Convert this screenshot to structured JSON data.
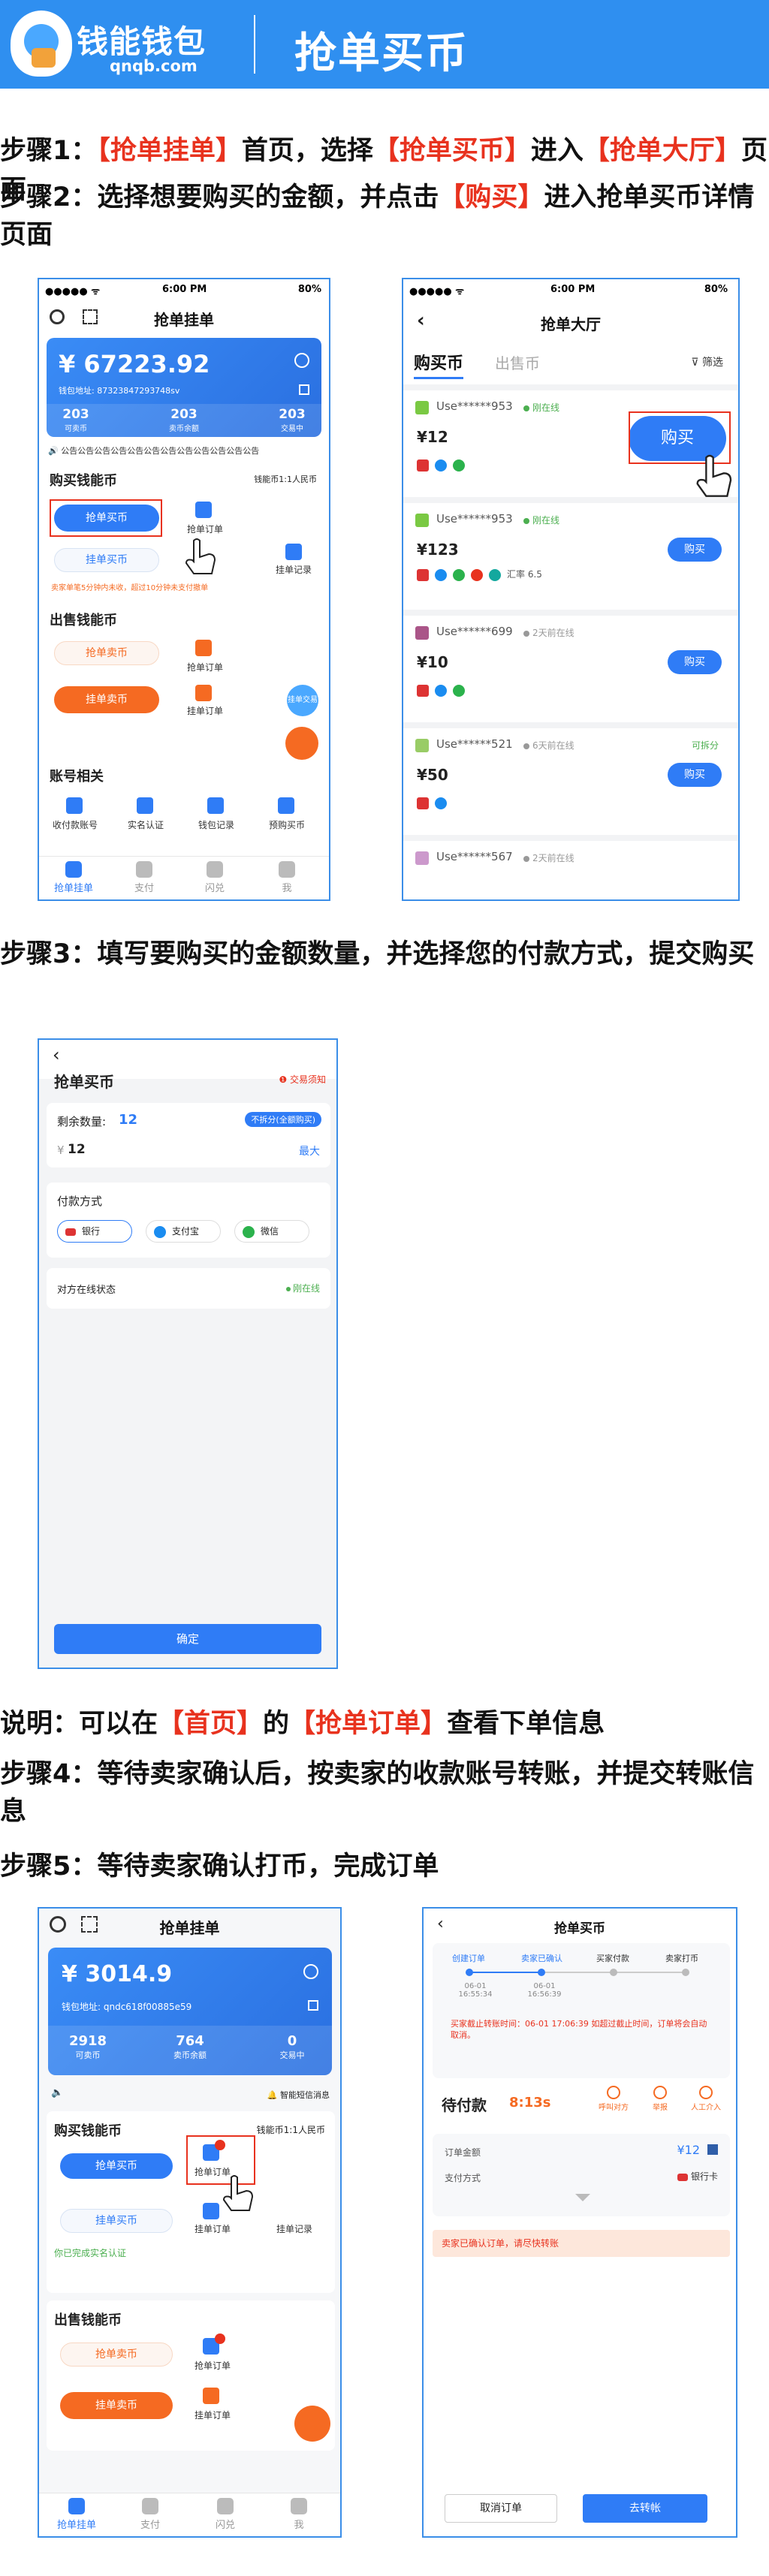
{
  "header": {
    "brand": "钱能钱包",
    "domain": "qnqb.com",
    "title": "抢单买币"
  },
  "steps": {
    "s1": {
      "pre": "步骤1：",
      "h1": "【抢单挂单】",
      "m1": "首页，选择",
      "h2": "【抢单买币】",
      "m2": "进入",
      "h3": "【抢单大厅】",
      "post": "页面"
    },
    "s2": {
      "pre": "步骤2：选择想要购买的金额，并点击",
      "h1": "【购买】",
      "post": "进入抢单买币详情页面"
    },
    "s3": {
      "text": "步骤3：填写要购买的金额数量，并选择您的付款方式，提交购买"
    },
    "note": {
      "pre": "说明：可以在",
      "h1": "【首页】",
      "m1": "的",
      "h2": "【抢单订单】",
      "post": "查看下单信息"
    },
    "s4": {
      "text": "步骤4：等待卖家确认后，按卖家的收款账号转账，并提交转账信息"
    },
    "s5": {
      "text": "步骤5：等待卖家确认打币，完成订单"
    }
  },
  "statusbar": {
    "carrier": "●●●●● ᯤ",
    "time": "6:00 PM",
    "battery": "80%"
  },
  "phone1": {
    "title": "抢单挂单",
    "amount": "¥ 67223.92",
    "address": "钱包地址: 87323847293748sv",
    "stats": [
      {
        "num": "203",
        "label": "可卖币"
      },
      {
        "num": "203",
        "label": "卖币余额"
      },
      {
        "num": "203",
        "label": "交易中"
      }
    ],
    "notice": "公告公告公告公告公告公告公告公告公告公告公告公告",
    "buy_title": "购买钱能币",
    "rate": "钱能币1:1人民币",
    "buy_btn": "抢单买币",
    "order_label": "抢单订单",
    "hang_buy": "挂单买币",
    "hang_record": "挂单记录",
    "warn": "卖家单笔5分钟内未收，超过10分钟未支付撤单",
    "sell_title": "出售钱能币",
    "sell_btn": "抢单卖币",
    "sell_order": "抢单订单",
    "hang_sell": "挂单卖币",
    "hang_sell_order": "挂单订单",
    "pay_fav": "挂单交易",
    "acct_title": "账号相关",
    "acct_items": [
      "收付款账号",
      "实名认证",
      "钱包记录",
      "预购买币"
    ],
    "nav": [
      "抢单挂单",
      "支付",
      "闪兑",
      "我"
    ]
  },
  "phone2": {
    "title": "抢单大厅",
    "tab_buy": "购买币",
    "tab_sell": "出售币",
    "filter": "筛选",
    "rows": [
      {
        "user": "Use******953",
        "status": "刚在线",
        "amount": "¥12",
        "btn": "购买",
        "extra": ""
      },
      {
        "user": "Use******953",
        "status": "刚在线",
        "amount": "¥123",
        "btn": "购买",
        "extra": "汇率 6.5"
      },
      {
        "user": "Use******699",
        "status": "2天前在线",
        "amount": "¥10",
        "btn": "购买",
        "extra": ""
      },
      {
        "user": "Use******521",
        "status": "6天前在线",
        "amount": "¥50",
        "btn": "购买",
        "extra": "可拆分"
      },
      {
        "user": "Use******567",
        "status": "2天前在线",
        "amount": "",
        "btn": "",
        "extra": ""
      }
    ]
  },
  "phone3": {
    "title": "抢单买币",
    "notice": "交易须知",
    "remain_label": "剩余数量:",
    "remain_val": "12",
    "split": "不拆分(全额购买)",
    "price_label": "¥",
    "price_val": "12",
    "buy_all": "最大",
    "pay_label": "付款方式",
    "pay_opts": [
      "银行",
      "支付宝",
      "微信"
    ],
    "online_label": "对方在线状态",
    "online_val": "刚在线",
    "confirm": "确定"
  },
  "phone4": {
    "title": "抢单挂单",
    "amount": "¥ 3014.9",
    "address": "钱包地址: qndc618f00885e59",
    "stats": [
      {
        "num": "2918",
        "label": "可卖币"
      },
      {
        "num": "764",
        "label": "卖币余额"
      },
      {
        "num": "0",
        "label": "交易中"
      }
    ],
    "notice": "智能短信消息",
    "buy_title": "购买钱能币",
    "rate": "钱能币1:1人民币",
    "buy_btn": "抢单买币",
    "order_label": "抢单订单",
    "hang_buy": "挂单买币",
    "hang_order": "挂单订单",
    "hang_record": "挂单记录",
    "warn": "你已完成实名认证",
    "sell_title": "出售钱能币",
    "sell_btn": "抢单卖币",
    "sell_order": "抢单订单",
    "hang_sell": "挂单卖币",
    "hang_sell_order": "挂单订单",
    "nav": [
      "抢单挂单",
      "支付",
      "闪兑",
      "我"
    ]
  },
  "phone5": {
    "title": "抢单买币",
    "steps": [
      "创建订单",
      "卖家已确认",
      "买家付款",
      "卖家打币"
    ],
    "times": [
      "06-01 16:55:34",
      "06-01 16:56:39"
    ],
    "warn": "买家截止转账时间：06-01 17:06:39 如超过截止时间，订单将会自动取消。",
    "wait_label": "待付款",
    "countdown": "8:13s",
    "icons": [
      "呼叫对方",
      "举报",
      "人工介入"
    ],
    "amount_label": "订单金额",
    "amount_val": "¥12",
    "pay_label": "支付方式",
    "pay_val": "银行卡",
    "confirmed": "卖家已确认订单，请尽快转账",
    "cancel": "取消订单",
    "transfer": "去转帐"
  },
  "colors": {
    "blue": "#2f8ff0",
    "red": "#e8321e",
    "orange": "#f56a22"
  }
}
